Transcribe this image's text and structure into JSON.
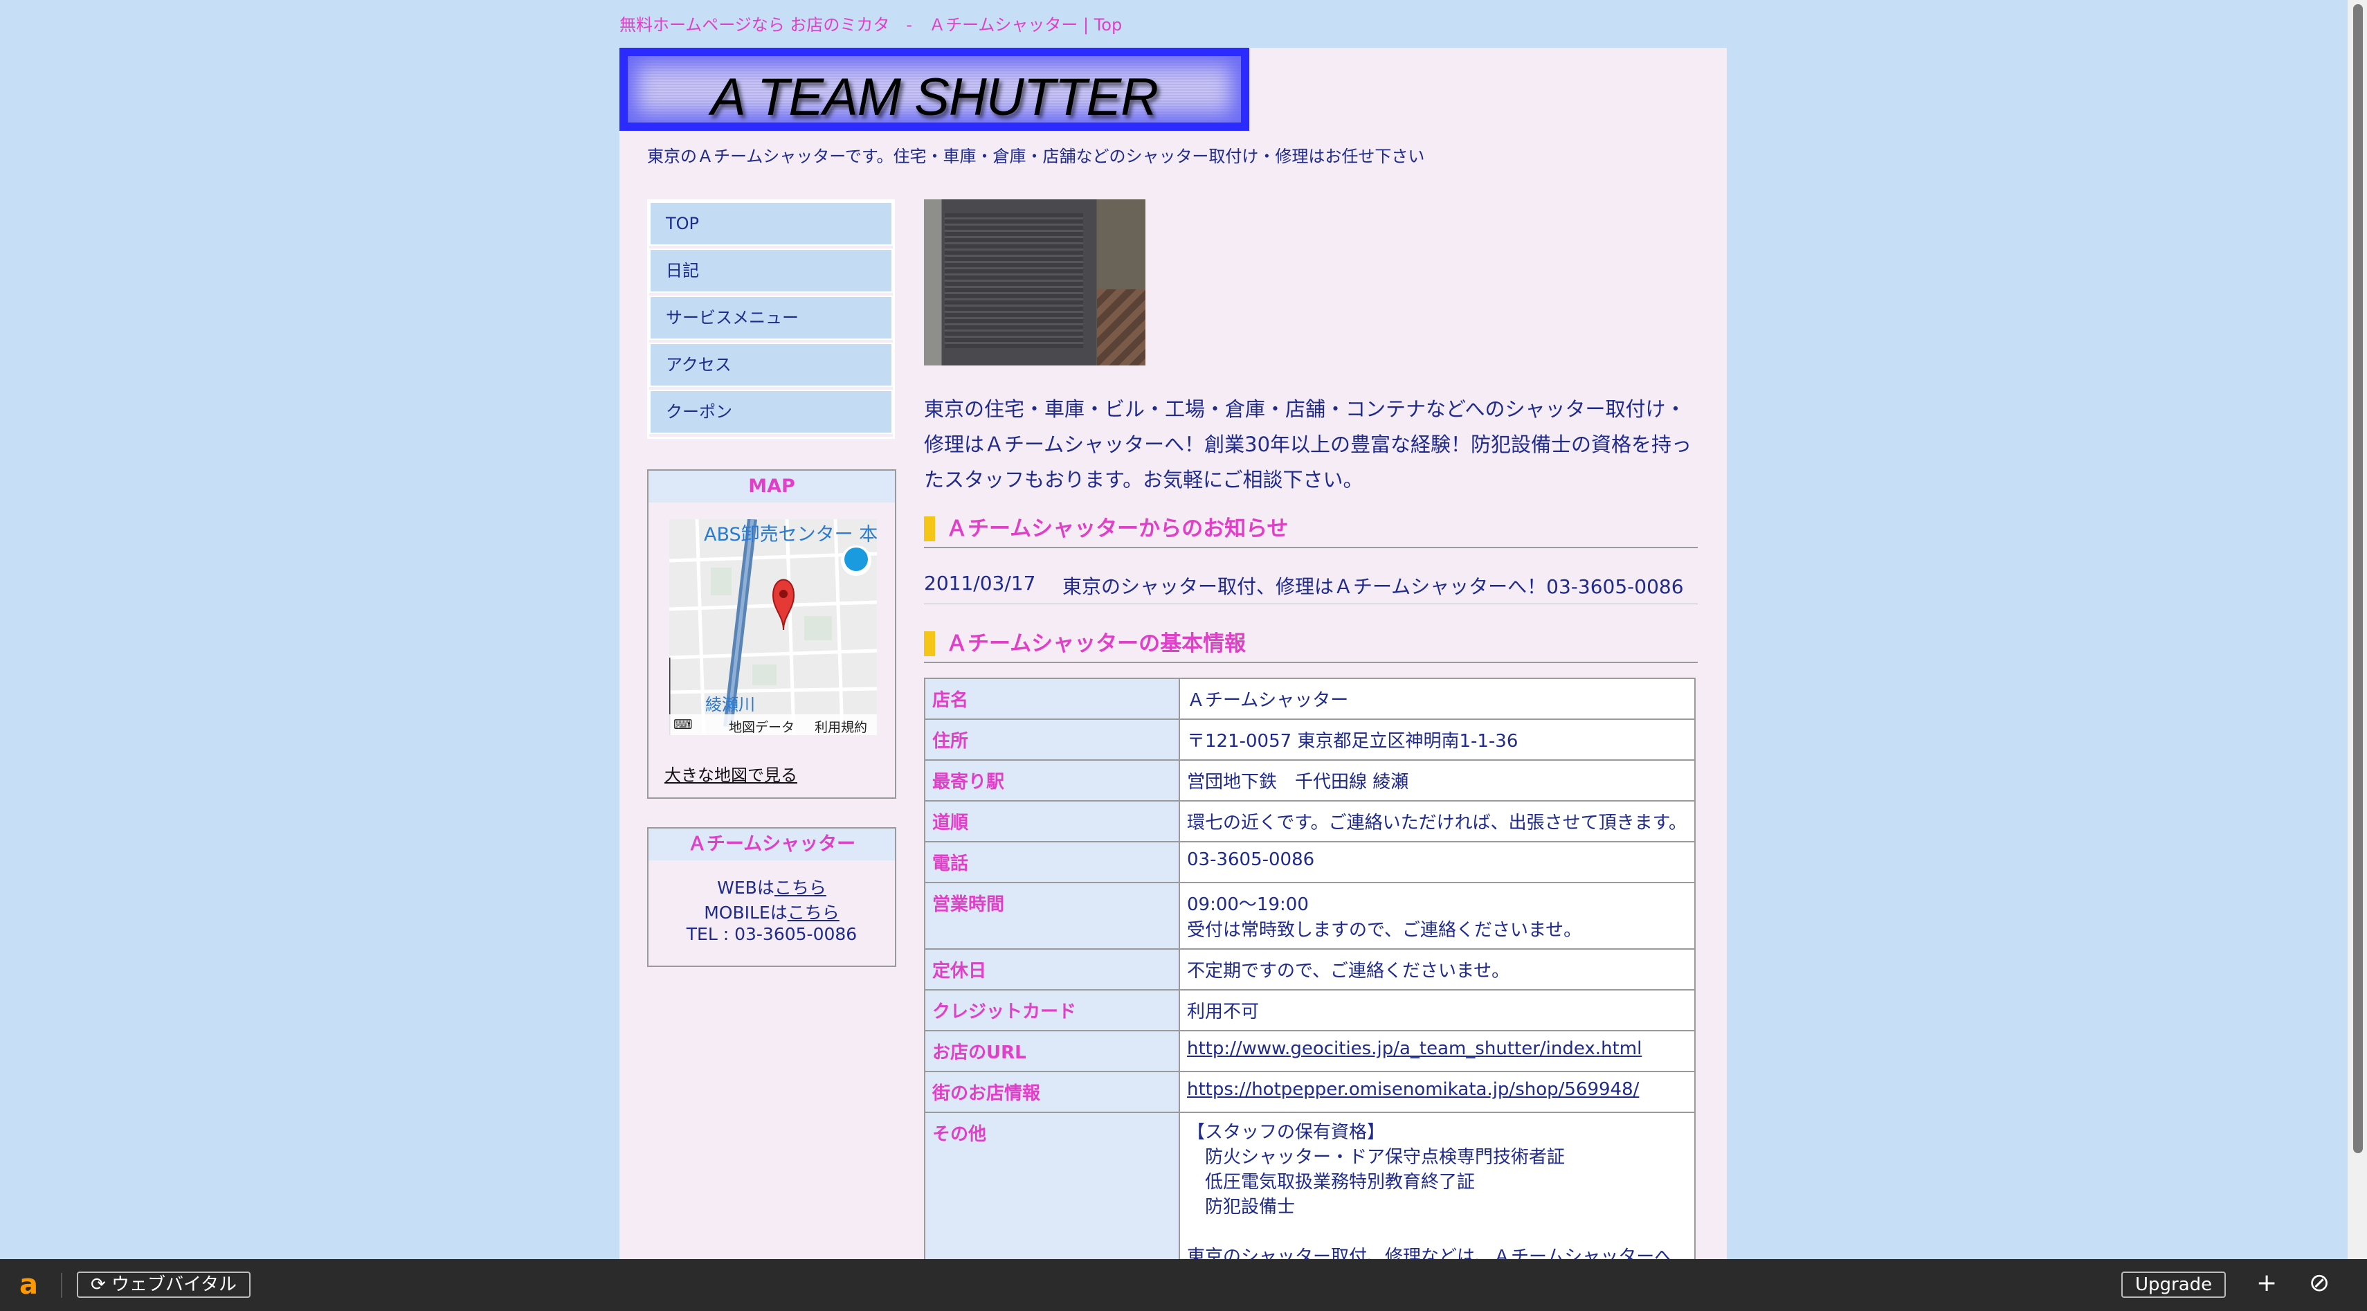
{
  "site_title": "無料ホームページなら お店のミカタ　-　Ａチームシャッター | Top",
  "logo": {
    "text": "A TEAM SHUTTER"
  },
  "tagline": "東京のＡチームシャッターです。住宅・車庫・倉庫・店舗などのシャッター取付け・修理はお任せ下さい",
  "nav": {
    "items": [
      "TOP",
      "日記",
      "サービスメニュー",
      "アクセス",
      "クーポン"
    ]
  },
  "map": {
    "title": "MAP",
    "label_top": "ABS卸売センター 本",
    "label_bottom": "綾瀬川",
    "footer_data": "地図データ",
    "footer_terms": "利用規約",
    "link": "大きな地図で見る"
  },
  "shop": {
    "title": "Ａチームシャッター",
    "web_prefix": "WEBは",
    "web_link": "こちら",
    "mobile_prefix": "MOBILEは",
    "mobile_link": "こちら",
    "tel": "TEL : 03-3605-0086"
  },
  "intro": "東京の住宅・車庫・ビル・工場・倉庫・店舗・コンテナなどへのシャッター取付け・修理はＡチームシャッターへ！創業30年以上の豊富な経験！防犯設備士の資格を持ったスタッフもおります。お気軽にご相談下さい。",
  "news": {
    "title": "Ａチームシャッターからのお知らせ",
    "date": "2011/03/17",
    "text": "東京のシャッター取付、修理はＡチームシャッターへ！03-3605-0086"
  },
  "basic_info": {
    "title": "Ａチームシャッターの基本情報",
    "rows": [
      {
        "key": "店名",
        "value": "Ａチームシャッター"
      },
      {
        "key": "住所",
        "value": "〒121-0057 東京都足立区神明南1-1-36"
      },
      {
        "key": "最寄り駅",
        "value": "営団地下鉄　千代田線 綾瀬"
      },
      {
        "key": "道順",
        "value": "環七の近くです。ご連絡いただければ、出張させて頂きます。"
      },
      {
        "key": "電話",
        "value": "03-3605-0086"
      },
      {
        "key": "営業時間",
        "value": "09:00～19:00",
        "value2": "受付は常時致しますので、ご連絡くださいませ。"
      },
      {
        "key": "定休日",
        "value": "不定期ですので、ご連絡くださいませ。"
      },
      {
        "key": "クレジットカード",
        "value": "利用不可"
      },
      {
        "key": "お店のURL",
        "value": "http://www.geocities.jp/a_team_shutter/index.html"
      },
      {
        "key": "街のお店情報",
        "value": "https://hotpepper.omisenomikata.jp/shop/569948/"
      },
      {
        "key": "その他",
        "lines": [
          "【スタッフの保有資格】",
          "　防火シャッター・ドア保守点検専門技術者証",
          "　低圧電気取扱業務特別教育終了証",
          "　防犯設備士",
          "",
          "東京のシャッター取付、修理などは、Ａチームシャッターへ"
        ]
      }
    ]
  },
  "bottombar": {
    "logo": "a",
    "reload_label": "⟳ ウェブバイタル",
    "upgrade_label": "Upgrade",
    "plus": "+",
    "block": "⊘"
  }
}
